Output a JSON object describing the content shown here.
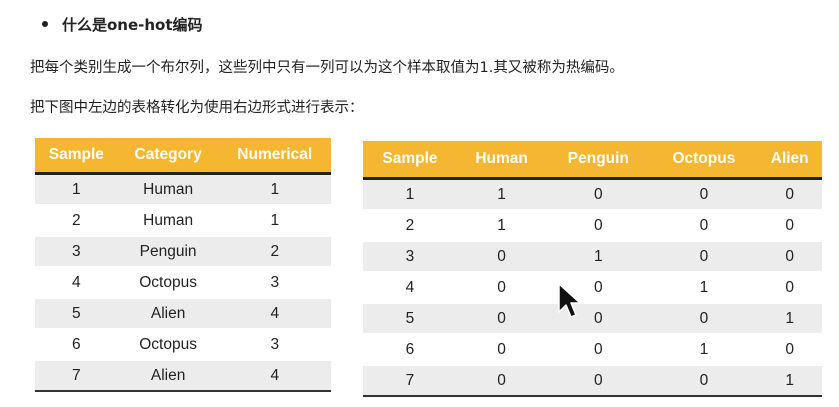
{
  "heading": "什么是one-hot编码",
  "paragraph1": "把每个类别生成一个布尔列，这些列中只有一列可以为这个样本取值为1.其又被称为热编码。",
  "paragraph2": "把下图中左边的表格转化为使用右边形式进行表示：",
  "left_table": {
    "headers": [
      "Sample",
      "Category",
      "Numerical"
    ],
    "rows": [
      [
        "1",
        "Human",
        "1"
      ],
      [
        "2",
        "Human",
        "1"
      ],
      [
        "3",
        "Penguin",
        "2"
      ],
      [
        "4",
        "Octopus",
        "3"
      ],
      [
        "5",
        "Alien",
        "4"
      ],
      [
        "6",
        "Octopus",
        "3"
      ],
      [
        "7",
        "Alien",
        "4"
      ]
    ]
  },
  "right_table": {
    "headers": [
      "Sample",
      "Human",
      "Penguin",
      "Octopus",
      "Alien"
    ],
    "rows": [
      [
        "1",
        "1",
        "0",
        "0",
        "0"
      ],
      [
        "2",
        "1",
        "0",
        "0",
        "0"
      ],
      [
        "3",
        "0",
        "1",
        "0",
        "0"
      ],
      [
        "4",
        "0",
        "0",
        "1",
        "0"
      ],
      [
        "5",
        "0",
        "0",
        "0",
        "1"
      ],
      [
        "6",
        "0",
        "0",
        "1",
        "0"
      ],
      [
        "7",
        "0",
        "0",
        "0",
        "1"
      ]
    ]
  },
  "colors": {
    "header_bg": "#f5b731",
    "header_text": "#ffffff",
    "stripe": "#ececec"
  },
  "icons": {
    "pointer": "mouse-pointer-icon"
  }
}
